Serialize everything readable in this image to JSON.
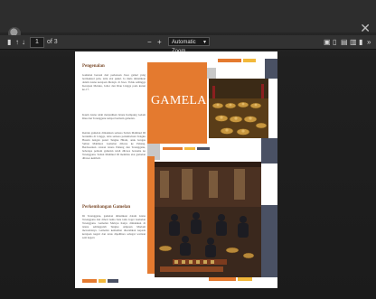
{
  "viewer": {
    "close_glyph": "✕",
    "page_current": "1",
    "page_count": "of 3",
    "zoom_value": "Automatic Zoom",
    "zoom_minus": "−",
    "zoom_plus": "+",
    "toolbar_icons": [
      "sidebar-toggle-icon",
      "up-icon",
      "down-icon",
      "presentation-icon",
      "open-file-icon",
      "print-icon",
      "download-icon",
      "bookmark-icon",
      "tools-icon"
    ]
  },
  "document": {
    "title": "GAMELAN",
    "section1_heading": "Pengenalan",
    "section1_p1": "Gamelan berasal dari perkataan Jawa gamel yang bermaksud palu, iaitu alat pukul. Ia mula dimainkan dalam istana kerajaan Melayu di Jawa. Tidak sehingga Kerajaan Melaka, Johor dan Riau Lingga pada kurun ke-17.",
    "section1_p2": "Kaum istana telah menjadikan Istana Kampung Gelam Riau dan Terengganu tempat bermain gamelan.",
    "section1_p3": "Rentak gamelan dimainkan semasa Sultan Mahmud III bertakhta di Lingga, iaitu semasa perkahwinan Tengku Hussin dengan puteri Tengku Hitam, anak bongsu Sultan Mahmud. Gamelan dibawa ke Pahang. Berdasarkan catatan istana Pahang dan Terengganu, beberapa pemain gamelan telah dibawa bersama ke Terengganu. Sultan Mahmud III meminta alat gamelan dibawa kembali.",
    "section2_heading": "Perkembangan Gamelan",
    "section2_p1": "Di Terengganu, gamelan dimainkan dalam istana Terengganu dan diberi nama baru iaitu Joget Gamelan Terengganu. Gamelan Melayu hanya dimainkan di istana sehinggalah Tengku Ampuan Mariam mewarisinya. Gamelan kemudian diserahkan kepada kerajaan negeri dan terus dipelihara sebagai warisan seni negeri."
  },
  "colors": {
    "orange": "#e47a2f",
    "yellow": "#f2b83b",
    "slate": "#4a5164",
    "grey": "#c8c8c8"
  }
}
